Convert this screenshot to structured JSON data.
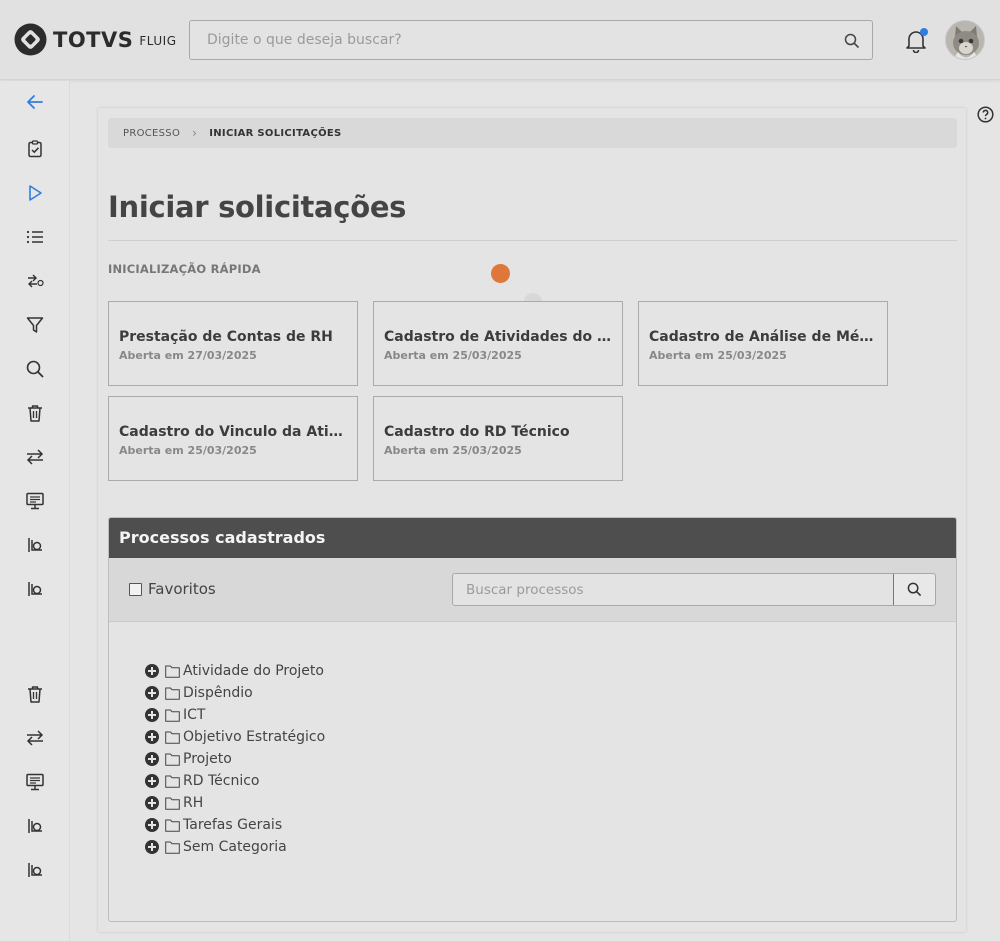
{
  "header": {
    "brand": "TOTVS",
    "product": "FLUIG",
    "search_placeholder": "Digite o que deseja buscar?",
    "colors": {
      "notification_dot": "#2f7de1",
      "accent": "#e0773a"
    }
  },
  "sidebar": {
    "items": [
      {
        "icon": "back-arrow-icon"
      },
      {
        "icon": "clipboard-check-icon"
      },
      {
        "icon": "play-icon"
      },
      {
        "icon": "list-icon"
      },
      {
        "icon": "workflow-icon"
      },
      {
        "icon": "filter-icon"
      },
      {
        "icon": "search-icon"
      },
      {
        "icon": "trash-icon"
      },
      {
        "icon": "transfer-icon"
      },
      {
        "icon": "monitor-icon"
      },
      {
        "icon": "hand-coins-icon"
      },
      {
        "icon": "hand-coins-icon"
      },
      {
        "icon": "trash-icon"
      },
      {
        "icon": "transfer-icon"
      },
      {
        "icon": "monitor-icon"
      },
      {
        "icon": "hand-coins-icon"
      },
      {
        "icon": "hand-coins-icon"
      }
    ]
  },
  "breadcrumb": {
    "parent": "PROCESSO",
    "current": "INICIAR SOLICITAÇÕES"
  },
  "page": {
    "title": "Iniciar solicitações",
    "quick_start_label": "INICIALIZAÇÃO RÁPIDA"
  },
  "quick_cards": [
    {
      "title": "Prestação de Contas de RH",
      "subtitle": "Aberta em 27/03/2025"
    },
    {
      "title": "Cadastro de Atividades do Projeto",
      "subtitle": "Aberta em 25/03/2025"
    },
    {
      "title": "Cadastro de Análise de Mérito",
      "subtitle": "Aberta em 25/03/2025"
    },
    {
      "title": "Cadastro do Vinculo da Atividade",
      "subtitle": "Aberta em 25/03/2025"
    },
    {
      "title": "Cadastro do RD Técnico",
      "subtitle": "Aberta em 25/03/2025"
    }
  ],
  "processes": {
    "title": "Processos cadastrados",
    "favorites_label": "Favoritos",
    "search_placeholder": "Buscar processos",
    "categories": [
      "Atividade do Projeto",
      "Dispêndio",
      "ICT",
      "Objetivo Estratégico",
      "Projeto",
      "RD Técnico",
      "RH",
      "Tarefas Gerais",
      "Sem Categoria"
    ]
  }
}
